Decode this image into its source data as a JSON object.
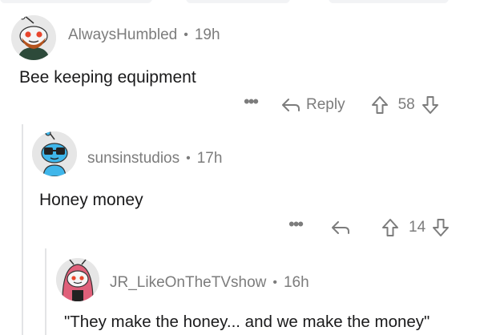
{
  "comments": [
    {
      "username": "AlwaysHumbled",
      "separator": "•",
      "age": "19h",
      "body": "Bee keeping equipment",
      "more": "•••",
      "reply_label": "Reply",
      "votes": "58"
    },
    {
      "username": "sunsinstudios",
      "separator": "•",
      "age": "17h",
      "body": "Honey money",
      "more": "•••",
      "reply_label": "",
      "votes": "14"
    },
    {
      "username": "JR_LikeOnTheTVshow",
      "separator": "•",
      "age": "16h",
      "body": "\"They make the honey... and we make the money\""
    }
  ],
  "icons": {
    "more": "ellipsis-icon",
    "reply": "reply-arrow-icon",
    "upvote": "upvote-arrow-icon",
    "downvote": "downvote-arrow-icon"
  },
  "colors": {
    "meta_text": "#7c7c7c",
    "body_text": "#1a1a1b",
    "thread_line": "#e3e4e6",
    "avatar1_bg": "#e8e8e8",
    "avatar2_bg": "#e6e6e6",
    "avatar2_snoo": "#3fb6ea",
    "avatar3_hood": "#e0607a"
  }
}
